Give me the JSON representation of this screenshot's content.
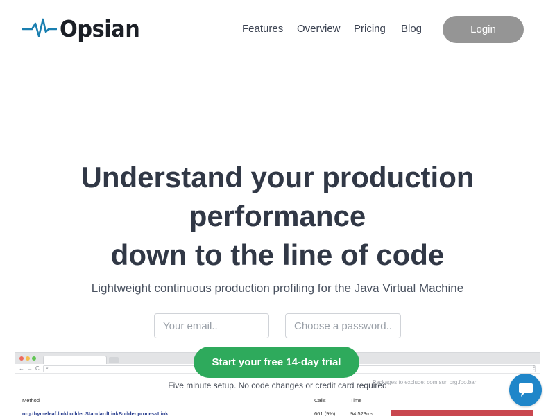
{
  "brand": {
    "name": "Opsian",
    "logo_icon": "pulse-icon",
    "logo_color": "#1a7fb0"
  },
  "nav": {
    "items": [
      {
        "label": "Features"
      },
      {
        "label": "Overview"
      },
      {
        "label": "Pricing"
      },
      {
        "label": "Blog"
      }
    ],
    "login_label": "Login"
  },
  "hero": {
    "title_line1": "Understand your production",
    "title_line2": "performance",
    "title_line3": "down to the line of code",
    "subtitle": "Lightweight continuous production profiling for the Java Virtual Machine"
  },
  "signup": {
    "email_placeholder": "Your email..",
    "password_placeholder": "Choose a password..",
    "cta_label": "Start your free 14-day trial",
    "cta_color": "#2eaa5c",
    "note": "Five minute setup. No code changes or credit card required"
  },
  "preview": {
    "exclude_hint": "Packages to exclude: com.sun org.foo.bar",
    "columns": [
      "Method",
      "Calls",
      "Time"
    ],
    "rows": [
      {
        "method": "org.thymeleaf.linkbuilder.StandardLinkBuilder.processLink",
        "calls": "661 (9%)",
        "time": "94,523ms"
      }
    ],
    "bar_color": "#c9474f"
  },
  "chat": {
    "icon": "chat-bubble-icon",
    "color": "#1f86c9"
  }
}
